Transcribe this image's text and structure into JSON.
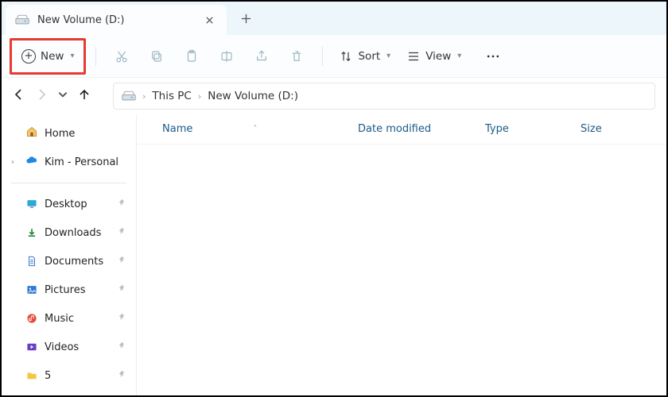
{
  "tab": {
    "title": "New Volume (D:)"
  },
  "toolbar": {
    "new_label": "New",
    "sort_label": "Sort",
    "view_label": "View"
  },
  "breadcrumb": {
    "root": "This PC",
    "current": "New Volume (D:)"
  },
  "sidebar": {
    "home": "Home",
    "cloud": "Kim - Personal",
    "quick": [
      {
        "label": "Desktop",
        "icon": "desktop",
        "color": "#2aa8d8"
      },
      {
        "label": "Downloads",
        "icon": "download",
        "color": "#2a8a3a"
      },
      {
        "label": "Documents",
        "icon": "document",
        "color": "#3a77c9"
      },
      {
        "label": "Pictures",
        "icon": "picture",
        "color": "#2f78d6"
      },
      {
        "label": "Music",
        "icon": "music",
        "color": "#e84d3b"
      },
      {
        "label": "Videos",
        "icon": "video",
        "color": "#6a3fc6"
      },
      {
        "label": "5",
        "icon": "folder",
        "color": "#f4c742"
      }
    ]
  },
  "columns": {
    "name": "Name",
    "date": "Date modified",
    "type": "Type",
    "size": "Size"
  }
}
